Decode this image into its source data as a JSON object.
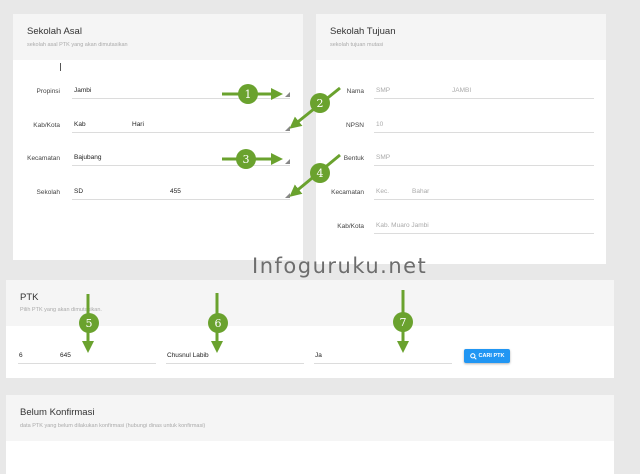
{
  "colors": {
    "background": "#e8e8e8",
    "card": "#ffffff",
    "card_header": "#f5f5f5",
    "accent": "#2196f3",
    "annotation": "#6aa22e"
  },
  "sekolah_asal": {
    "title": "Sekolah Asal",
    "subtitle": "sekolah asal PTK yang akan dimutasikan",
    "fields": {
      "propinsi": {
        "label": "Propinsi",
        "value": "Jambi"
      },
      "kabkota": {
        "label": "Kab/Kota",
        "value_a": "Kab",
        "value_b": "Hari"
      },
      "kecamatan": {
        "label": "Kecamatan",
        "value": "Bajubang"
      },
      "sekolah": {
        "label": "Sekolah",
        "value_a": "SD",
        "value_b": "455"
      }
    }
  },
  "sekolah_tujuan": {
    "title": "Sekolah Tujuan",
    "subtitle": "sekolah tujuan mutasi",
    "fields": {
      "nama": {
        "label": "Nama",
        "value_a": "SMP",
        "value_b": "JAMBI"
      },
      "npsn": {
        "label": "NPSN",
        "value": "10"
      },
      "bentuk": {
        "label": "Bentuk",
        "value": "SMP"
      },
      "kecamatan": {
        "label": "Kecamatan",
        "value_a": "Kec.",
        "value_b": "Bahar"
      },
      "kabkota": {
        "label": "Kab/Kota",
        "value": "Kab. Muaro Jambi"
      }
    }
  },
  "ptk": {
    "title": "PTK",
    "subtitle": "Pilih PTK yang akan dimutasikan.",
    "nip": {
      "value_a": "6",
      "value_b": "645"
    },
    "nama": {
      "value": "Chusnul Labib"
    },
    "jabatan": {
      "value": "Ja"
    },
    "search_button": {
      "icon": "search-icon",
      "label": "CARI PTK"
    }
  },
  "belum_konfirmasi": {
    "title": "Belum Konfirmasi",
    "subtitle": "data PTK yang belum dilakukan konfirmasi (hubungi dinas untuk konfirmasi)"
  },
  "watermark": "Infoguruku.net",
  "annotations": [
    "1",
    "2",
    "3",
    "4",
    "5",
    "6",
    "7"
  ]
}
